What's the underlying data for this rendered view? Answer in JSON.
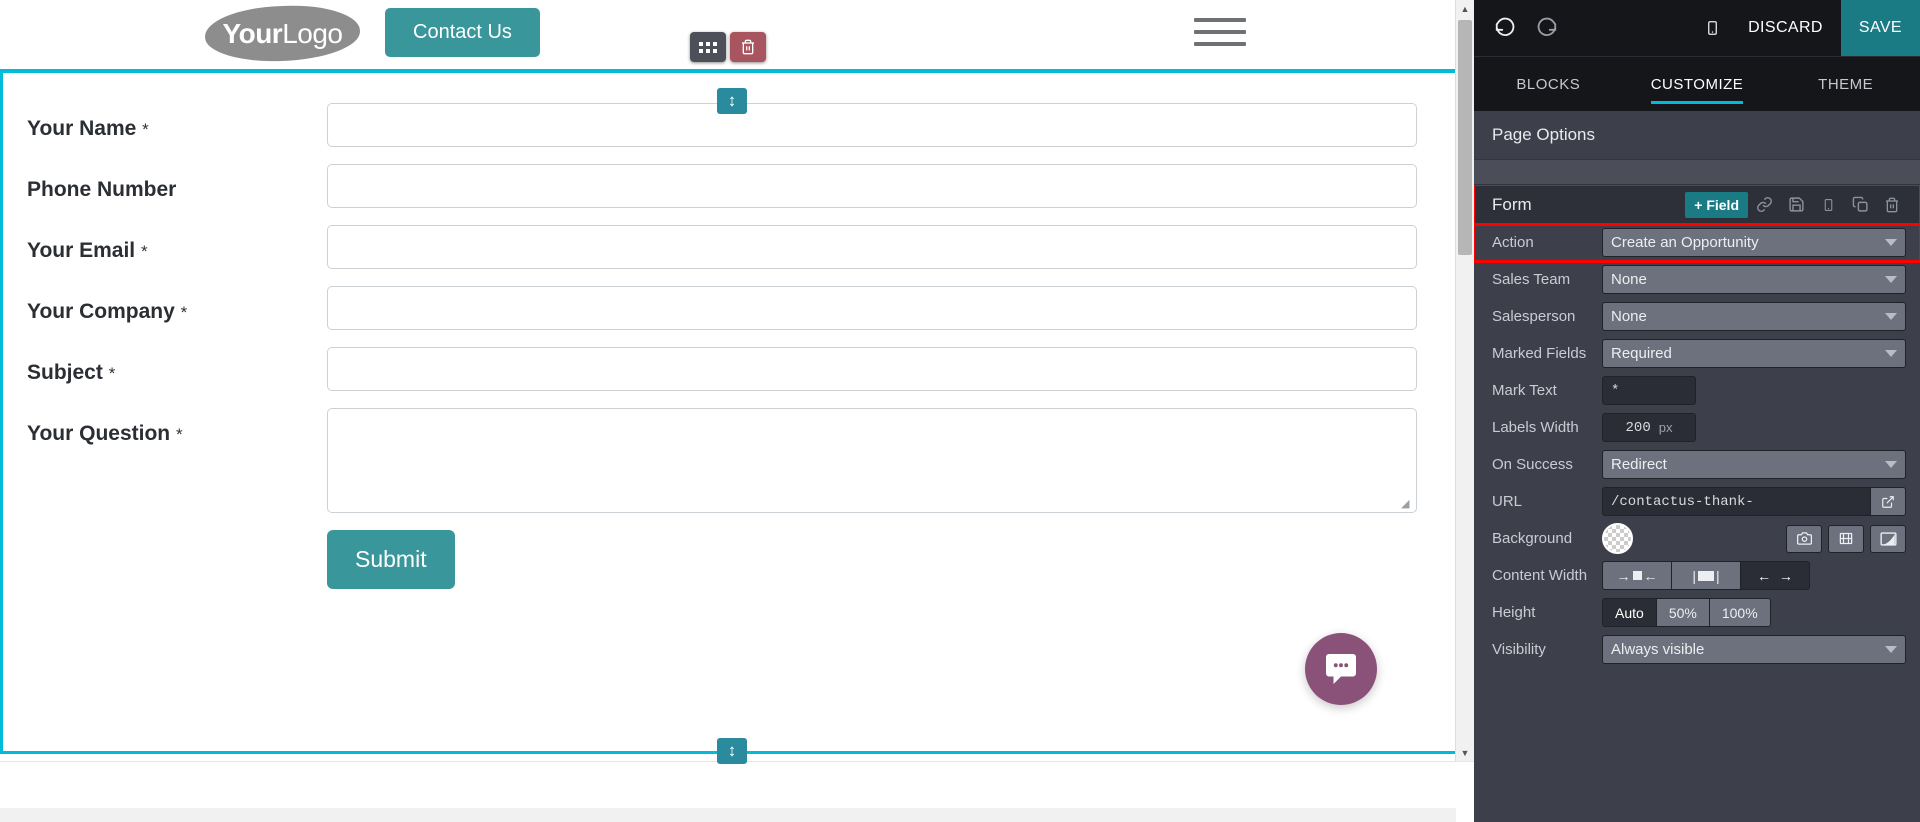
{
  "preview": {
    "logo": {
      "bold": "Your",
      "light": "Logo",
      "name": "your-logo"
    },
    "contact_button": "Contact Us",
    "block_toolbar": {
      "drag_icon": "grid-icon",
      "delete_icon": "trash-icon"
    },
    "form": {
      "fields": [
        {
          "label": "Your Name",
          "mark": "*",
          "type": "input"
        },
        {
          "label": "Phone Number",
          "mark": "",
          "type": "input"
        },
        {
          "label": "Your Email",
          "mark": "*",
          "type": "input"
        },
        {
          "label": "Your Company",
          "mark": "*",
          "type": "input"
        },
        {
          "label": "Subject",
          "mark": "*",
          "type": "input"
        },
        {
          "label": "Your Question",
          "mark": "*",
          "type": "textarea"
        }
      ],
      "submit_label": "Submit"
    },
    "chat_icon": "chat-bubble-icon",
    "accent_selection": "#00bcd9",
    "brand_teal": "#39969b",
    "chat_color": "#8a5179"
  },
  "editor": {
    "toolbar": {
      "undo_icon": "undo-icon",
      "redo_icon": "redo-icon",
      "mobile_icon": "mobile-preview-icon",
      "discard_label": "DISCARD",
      "save_label": "SAVE",
      "save_color": "#1b7b85"
    },
    "tabs": [
      {
        "label": "BLOCKS",
        "active": false
      },
      {
        "label": "CUSTOMIZE",
        "active": true
      },
      {
        "label": "THEME",
        "active": false
      }
    ],
    "page_options_title": "Page Options",
    "form_header": {
      "title": "Form",
      "add_field_label": "+ Field",
      "icons": [
        "link-icon",
        "save-disk-icon",
        "mobile-icon",
        "duplicate-icon",
        "trash-icon"
      ],
      "highlighted": true
    },
    "options": [
      {
        "name": "action",
        "label": "Action",
        "control": "select",
        "value": "Create an Opportunity",
        "highlighted": true
      },
      {
        "name": "sales-team",
        "label": "Sales Team",
        "control": "select",
        "value": "None"
      },
      {
        "name": "salesperson",
        "label": "Salesperson",
        "control": "select",
        "value": "None"
      },
      {
        "name": "marked-fields",
        "label": "Marked Fields",
        "control": "select",
        "value": "Required"
      },
      {
        "name": "mark-text",
        "label": "Mark Text",
        "control": "text",
        "value": "*"
      },
      {
        "name": "labels-width",
        "label": "Labels Width",
        "control": "number",
        "value": "200",
        "unit": "px"
      },
      {
        "name": "on-success",
        "label": "On Success",
        "control": "select",
        "value": "Redirect"
      },
      {
        "name": "url",
        "label": "URL",
        "control": "url",
        "value": "/contactus-thank-",
        "button_icon": "external-link-icon"
      },
      {
        "name": "background",
        "label": "Background",
        "control": "background",
        "swatch": "transparent",
        "buttons": [
          "camera-icon",
          "video-icon",
          "gradient-icon"
        ]
      },
      {
        "name": "content-width",
        "label": "Content Width",
        "control": "segmented-icons",
        "segments": [
          "narrow-icon",
          "medium-icon",
          "wide-icon"
        ],
        "selected_index": 2
      },
      {
        "name": "height",
        "label": "Height",
        "control": "segmented",
        "segments": [
          "Auto",
          "50%",
          "100%"
        ],
        "selected_index": 0
      },
      {
        "name": "visibility",
        "label": "Visibility",
        "control": "select",
        "value": "Always visible"
      }
    ],
    "highlight_color": "#fe0000",
    "accent_color": "#00bcd9"
  }
}
